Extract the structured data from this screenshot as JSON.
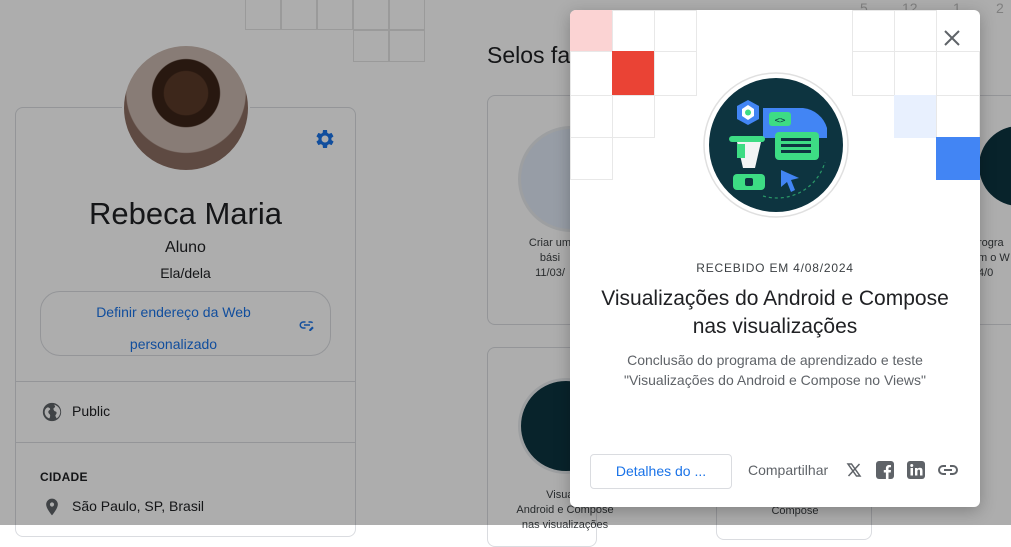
{
  "profile": {
    "name": "Rebeca Maria",
    "role": "Aluno",
    "pronouns": "Ela/dela",
    "custom_url_line1": "Definir endereço da Web",
    "custom_url_line2": "personalizado",
    "visibility": "Public",
    "city_label": "CIDADE",
    "city": "São Paulo, SP, Brasil"
  },
  "badges_section": {
    "title": "Selos fa",
    "cards": [
      {
        "line1": "Criar um",
        "line2": "bási",
        "date": "11/03/"
      },
      {
        "line1": "Visualiz",
        "line2": "Android e Compose",
        "line3": "nas visualizações"
      },
      {
        "line1": "Compose"
      },
      {
        "line1": "rogra",
        "line2": "m o W",
        "date": "4/0"
      }
    ],
    "grid_numbers": [
      "5",
      "12",
      "1",
      "2"
    ]
  },
  "dialog": {
    "received": "RECEBIDO EM 4/08/2024",
    "title_line1": "Visualizações do Android e Compose",
    "title_line2": "nas visualizações",
    "desc_line1": "Conclusão do programa de aprendizado e teste",
    "desc_line2": "\"Visualizações do Android e Compose no Views\"",
    "details_button": "Detalhes do ...",
    "share_label": "Compartilhar",
    "share_icons": [
      "x-icon",
      "facebook-icon",
      "linkedin-icon",
      "link-icon"
    ],
    "close_icon": "close-icon"
  },
  "colors": {
    "accent": "#1a73e8",
    "red": "#ea4335",
    "pink": "#fbd3d3",
    "blue": "#4285f4",
    "light_blue": "#e8f0fe",
    "badge_dark": "#0d3440",
    "badge_green": "#3ddc84"
  }
}
